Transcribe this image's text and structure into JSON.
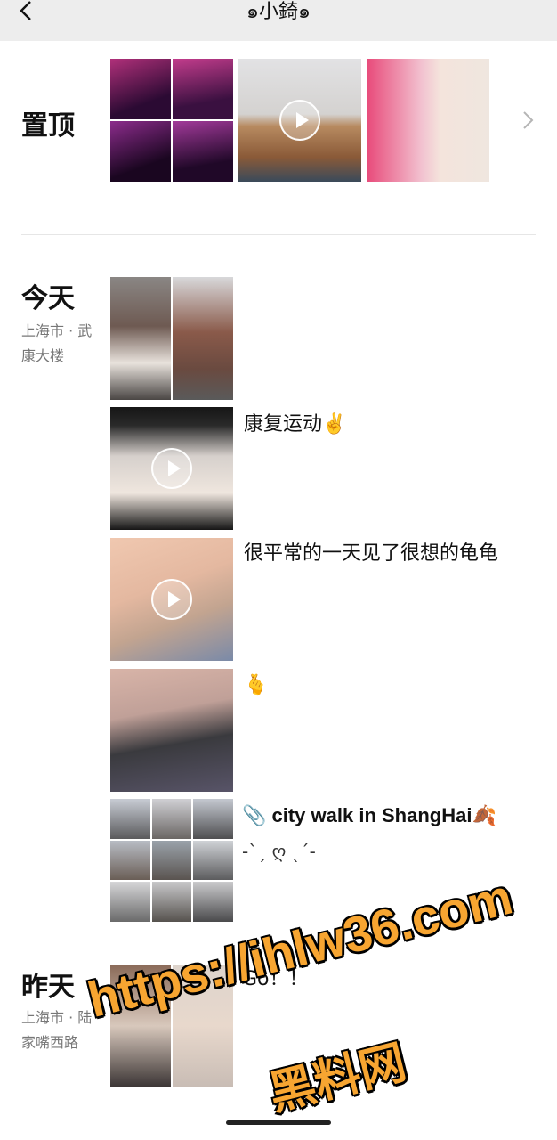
{
  "header": {
    "title": "๑小錡๑",
    "back_icon": "chevron-left-icon"
  },
  "pinned": {
    "label": "置顶",
    "more_icon": "chevron-right-icon"
  },
  "today": {
    "label": "今天",
    "location": "上海市 · 武康大楼",
    "posts": [
      {
        "text": ""
      },
      {
        "text": "康复运动✌️"
      },
      {
        "text": "很平常的一天见了很想的龟龟"
      },
      {
        "text": "🫰"
      },
      {
        "text": "📎 city walk in ShangHai🍂",
        "subtext": "-ˋˏ ღ ˎˊ-"
      }
    ]
  },
  "yesterday": {
    "label": "昨天",
    "location": "上海市 · 陆家嘴西路",
    "posts": [
      {
        "text": "Go！！"
      }
    ]
  },
  "watermark": {
    "line1": "https://ihlw36.com",
    "line2": "黑料网"
  }
}
